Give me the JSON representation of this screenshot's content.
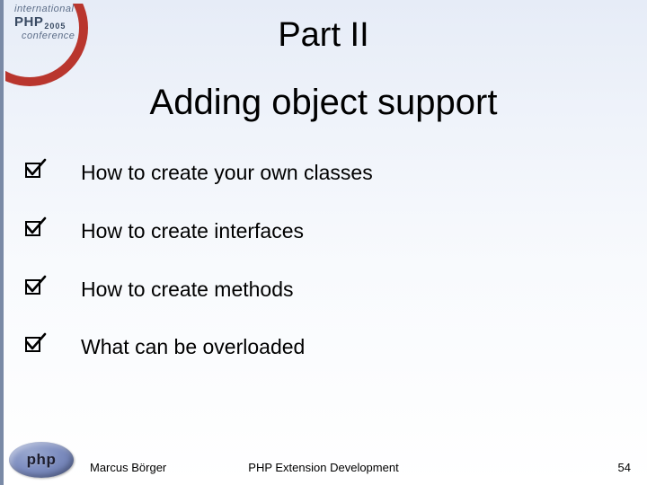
{
  "conference_logo": {
    "line1": "international",
    "line2_main": "PHP",
    "line2_sub": "2005",
    "line3": "conference"
  },
  "title_part": "Part II",
  "title_main": "Adding object support",
  "bullets": [
    {
      "text": "How to create your own classes"
    },
    {
      "text": "How to create interfaces"
    },
    {
      "text": "How to create methods"
    },
    {
      "text": "What can be overloaded"
    }
  ],
  "php_logo_text": "php",
  "footer": {
    "author": "Marcus Börger",
    "center": "PHP Extension Development",
    "page": "54"
  }
}
